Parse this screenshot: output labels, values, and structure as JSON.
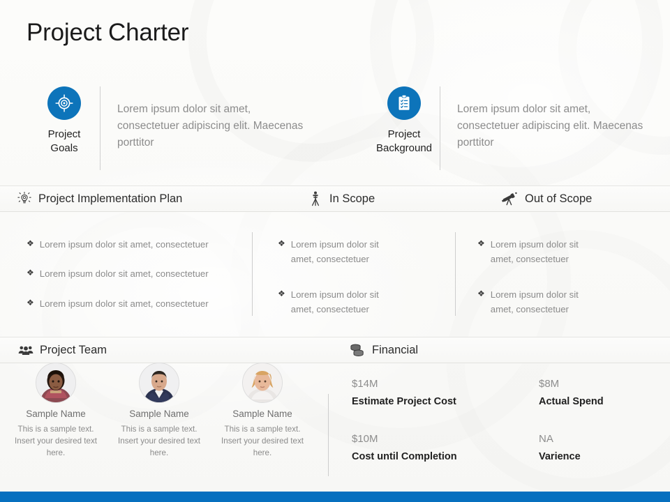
{
  "slide": {
    "title": "Project Charter",
    "accent_color": "#0670bf",
    "icon_circle_color": "#0d74ba",
    "background_color": "#fbfbf9"
  },
  "top_cards": [
    {
      "icon": "target-icon",
      "label_line1": "Project",
      "label_line2": "Goals",
      "body": "Lorem ipsum dolor sit amet, consectetuer adipiscing elit. Maecenas porttitor"
    },
    {
      "icon": "clipboard-checklist-icon",
      "label_line1": "Project",
      "label_line2": "Background",
      "body": "Lorem ipsum dolor sit amet, consectetuer adipiscing elit. Maecenas porttitor"
    }
  ],
  "scope_headers": [
    {
      "icon": "lightbulb-icon",
      "label": "Project Implementation Plan"
    },
    {
      "icon": "tripod-icon",
      "label": "In Scope"
    },
    {
      "icon": "telescope-icon",
      "label": "Out of Scope"
    }
  ],
  "scope_columns": [
    {
      "bullet": "❖",
      "items": [
        "Lorem ipsum dolor sit amet, consectetuer",
        "Lorem ipsum dolor sit amet, consectetuer",
        "Lorem ipsum dolor sit amet, consectetuer"
      ]
    },
    {
      "bullet": "❖",
      "items": [
        "Lorem ipsum dolor sit amet, consectetuer",
        "Lorem ipsum dolor sit amet, consectetuer"
      ]
    },
    {
      "bullet": "❖",
      "items": [
        "Lorem ipsum dolor sit amet, consectetuer",
        "Lorem ipsum dolor sit amet, consectetuer"
      ]
    }
  ],
  "bottom_headers": [
    {
      "icon": "people-group-icon",
      "label": "Project Team"
    },
    {
      "icon": "coins-stack-icon",
      "label": "Financial"
    }
  ],
  "team": [
    {
      "avatar": "avatar-photo-1",
      "name": "Sample Name",
      "desc": "This is a sample text. Insert your desired text here."
    },
    {
      "avatar": "avatar-photo-2",
      "name": "Sample Name",
      "desc": "This is a sample text. Insert your desired text here."
    },
    {
      "avatar": "avatar-photo-3",
      "name": "Sample Name",
      "desc": "This is a sample text. Insert your desired text here."
    }
  ],
  "financial": [
    {
      "value": "$14M",
      "label": "Estimate Project Cost"
    },
    {
      "value": "$8M",
      "label": "Actual Spend"
    },
    {
      "value": "$10M",
      "label": "Cost until Completion"
    },
    {
      "value": "NA",
      "label": "Varience"
    }
  ]
}
